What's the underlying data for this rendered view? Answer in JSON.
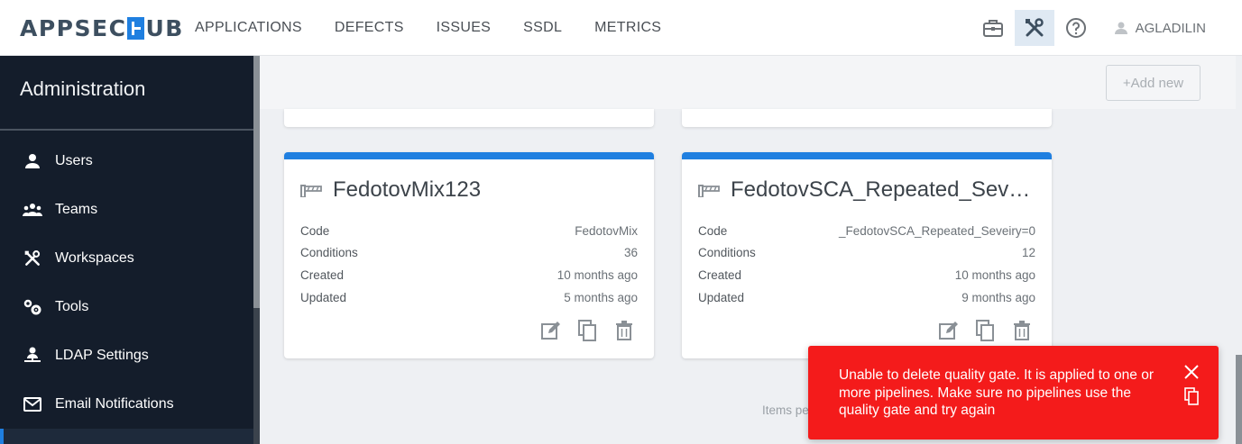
{
  "app": {
    "logo_left": "APPSEC",
    "logo_right": "UB"
  },
  "nav": [
    "APPLICATIONS",
    "DEFECTS",
    "ISSUES",
    "SSDL",
    "METRICS"
  ],
  "header": {
    "icons": [
      "briefcase-icon",
      "tools-icon",
      "help-icon"
    ],
    "user_name": "AGLADILIN"
  },
  "sidebar": {
    "title": "Administration",
    "items": [
      {
        "label": "Users",
        "icon": "user-icon"
      },
      {
        "label": "Teams",
        "icon": "team-icon"
      },
      {
        "label": "Workspaces",
        "icon": "tools-icon"
      },
      {
        "label": "Tools",
        "icon": "gears-icon"
      },
      {
        "label": "LDAP Settings",
        "icon": "ldap-icon"
      },
      {
        "label": "Email Notifications",
        "icon": "mail-icon"
      }
    ]
  },
  "actions": {
    "add_new": "+Add new"
  },
  "cards": [
    {
      "title": "FedotovMix123",
      "fields": [
        {
          "label": "Code",
          "value": "FedotovMix"
        },
        {
          "label": "Conditions",
          "value": "36"
        },
        {
          "label": "Created",
          "value": "10 months ago"
        },
        {
          "label": "Updated",
          "value": "5 months ago"
        }
      ]
    },
    {
      "title": "FedotovSCA_Repeated_Seveiry",
      "fields": [
        {
          "label": "Code",
          "value": "_FedotovSCA_Repeated_Seveiry=0"
        },
        {
          "label": "Conditions",
          "value": "12"
        },
        {
          "label": "Created",
          "value": "10 months ago"
        },
        {
          "label": "Updated",
          "value": "9 months ago"
        }
      ]
    }
  ],
  "pager": {
    "label": "Items pe"
  },
  "toast": {
    "message": "Unable to delete quality gate. It is applied to one or more pipelines. Make sure no pipelines use the quality gate and try again",
    "color": "#f41b1b"
  },
  "colors": {
    "accent": "#1f7fe0",
    "sidebar_bg": "#141d2b"
  }
}
